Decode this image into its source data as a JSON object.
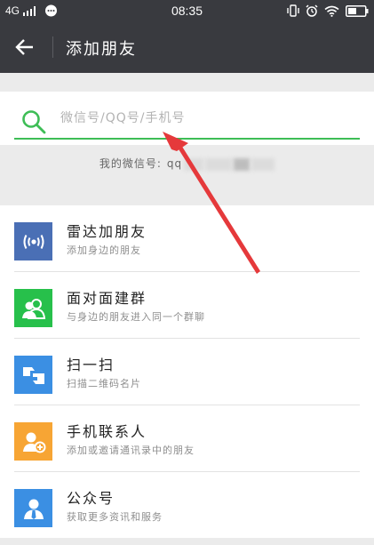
{
  "status_bar": {
    "network": "4G",
    "time": "08:35"
  },
  "header": {
    "title": "添加朋友",
    "back_icon": "arrow-left-icon"
  },
  "search": {
    "placeholder": "微信号/QQ号/手机号",
    "icon": "search-icon",
    "accent_color": "#3ebd56"
  },
  "my_id": {
    "label": "我的微信号:",
    "value_visible": "qq"
  },
  "menu": [
    {
      "label": "雷达加朋友",
      "desc": "添加身边的朋友",
      "icon": "radar-icon",
      "color": "#4a6fb5"
    },
    {
      "label": "面对面建群",
      "desc": "与身边的朋友进入同一个群聊",
      "icon": "face-to-face-group-icon",
      "color": "#27c04b"
    },
    {
      "label": "扫一扫",
      "desc": "扫描二维码名片",
      "icon": "scan-icon",
      "color": "#3b8fe3"
    },
    {
      "label": "手机联系人",
      "desc": "添加或邀请通讯录中的朋友",
      "icon": "phone-contacts-icon",
      "color": "#f7a534"
    },
    {
      "label": "公众号",
      "desc": "获取更多资讯和服务",
      "icon": "official-account-icon",
      "color": "#3b8fe3"
    }
  ]
}
